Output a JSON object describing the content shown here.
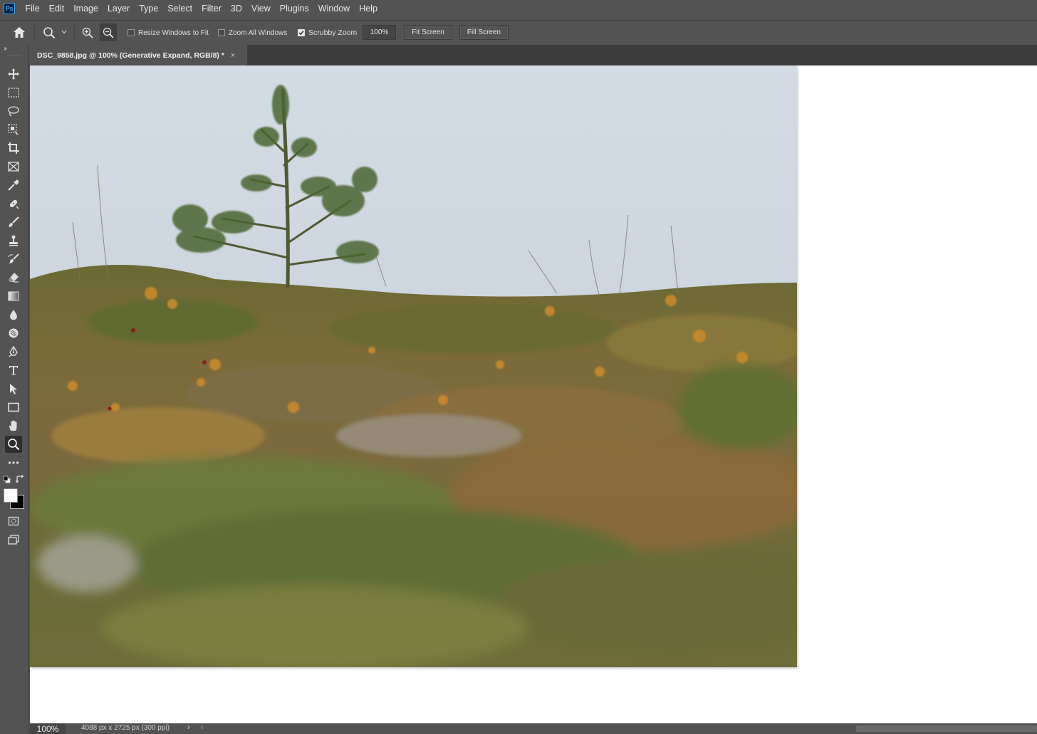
{
  "app": {
    "logo_text": "Ps"
  },
  "menu": [
    "File",
    "Edit",
    "Image",
    "Layer",
    "Type",
    "Select",
    "Filter",
    "3D",
    "View",
    "Plugins",
    "Window",
    "Help"
  ],
  "options": {
    "resize_windows": {
      "label": "Resize Windows to Fit",
      "checked": false
    },
    "zoom_all_windows": {
      "label": "Zoom All Windows",
      "checked": false
    },
    "scrubby_zoom": {
      "label": "Scrubby Zoom",
      "checked": true
    },
    "zoom_value": "100%",
    "fit_screen_label": "Fit Screen",
    "fill_screen_label": "Fill Screen"
  },
  "document": {
    "tab_title": "DSC_9858.jpg @ 100% (Generative Expand, RGB/8) *",
    "close_glyph": "×"
  },
  "tools": [
    "move-tool",
    "rectangular-marquee-tool",
    "lasso-tool",
    "object-selection-tool",
    "crop-tool",
    "frame-tool",
    "eyedropper-tool",
    "spot-healing-brush-tool",
    "brush-tool",
    "clone-stamp-tool",
    "history-brush-tool",
    "eraser-tool",
    "gradient-tool",
    "blur-tool",
    "dodge-tool",
    "pen-tool",
    "type-tool",
    "path-selection-tool",
    "rectangle-tool",
    "hand-tool",
    "zoom-tool",
    "edit-toolbar"
  ],
  "active_tool": "zoom-tool",
  "colors": {
    "foreground": "#ffffff",
    "background": "#000000",
    "ui_bg": "#535353",
    "dark_bg": "#3c3c3c"
  },
  "status": {
    "zoom": "100%",
    "doc_info": "4088 px x 2725 px (300 ppi)",
    "arrow": "›",
    "scroll_left": "‹"
  }
}
